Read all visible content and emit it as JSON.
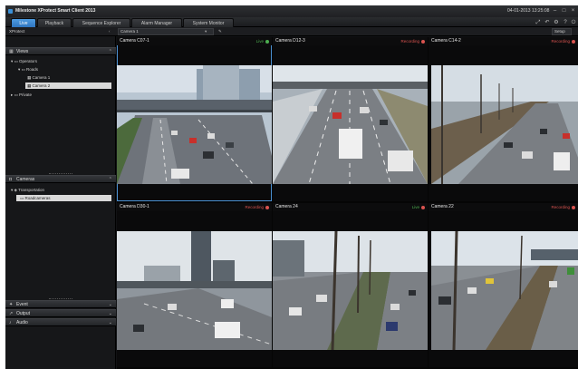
{
  "window": {
    "title": "Milestone XProtect Smart Client 2013",
    "clock": "04-01-2013 13:25:08"
  },
  "tabs": [
    {
      "label": "Live",
      "active": true
    },
    {
      "label": "Playback",
      "active": false
    },
    {
      "label": "Sequence Explorer",
      "active": false
    },
    {
      "label": "Alarm Manager",
      "active": false
    },
    {
      "label": "System Monitor",
      "active": false
    }
  ],
  "viewbar": {
    "site": "XProtect",
    "view_name": "Camera 1",
    "setup_label": "Setup"
  },
  "views_panel": {
    "title": "Views",
    "tree": [
      {
        "label": "Operators",
        "level": 0,
        "selected": false
      },
      {
        "label": "Roads",
        "level": 1,
        "selected": false
      },
      {
        "label": "Camera 1",
        "level": 2,
        "selected": false
      },
      {
        "label": "Camera 2",
        "level": 2,
        "selected": true
      },
      {
        "label": "Private",
        "level": 0,
        "selected": false
      }
    ]
  },
  "cameras_panel": {
    "title": "Cameras",
    "tree": [
      {
        "label": "Transportation",
        "level": 0,
        "selected": false
      },
      {
        "label": "Roadcameras",
        "level": 1,
        "selected": true
      }
    ]
  },
  "bottom_panels": [
    {
      "label": "Event"
    },
    {
      "label": "Output"
    },
    {
      "label": "Audio"
    }
  ],
  "cameras": [
    {
      "name": "Camera C07-1",
      "status": "Live",
      "status_color": "#4caf50",
      "dot_color": "#4caf50",
      "selected": true
    },
    {
      "name": "Camera D12-3",
      "status": "Recording",
      "status_color": "#d9534f",
      "dot_color": "#d9534f",
      "selected": false
    },
    {
      "name": "Camera C14-2",
      "status": "Recording",
      "status_color": "#d9534f",
      "dot_color": "#d9534f",
      "selected": false
    },
    {
      "name": "Camera D30-1",
      "status": "Recording",
      "status_color": "#d9534f",
      "dot_color": "#d9534f",
      "selected": false
    },
    {
      "name": "Camera 24",
      "status": "Live",
      "status_color": "#4caf50",
      "dot_color": "#d9534f",
      "selected": false
    },
    {
      "name": "Camera 22",
      "status": "Recording",
      "status_color": "#d9534f",
      "dot_color": "#d9534f",
      "selected": false
    }
  ],
  "colors": {
    "accent": "#3a8fd6",
    "live": "#4caf50",
    "recording": "#d9534f"
  }
}
